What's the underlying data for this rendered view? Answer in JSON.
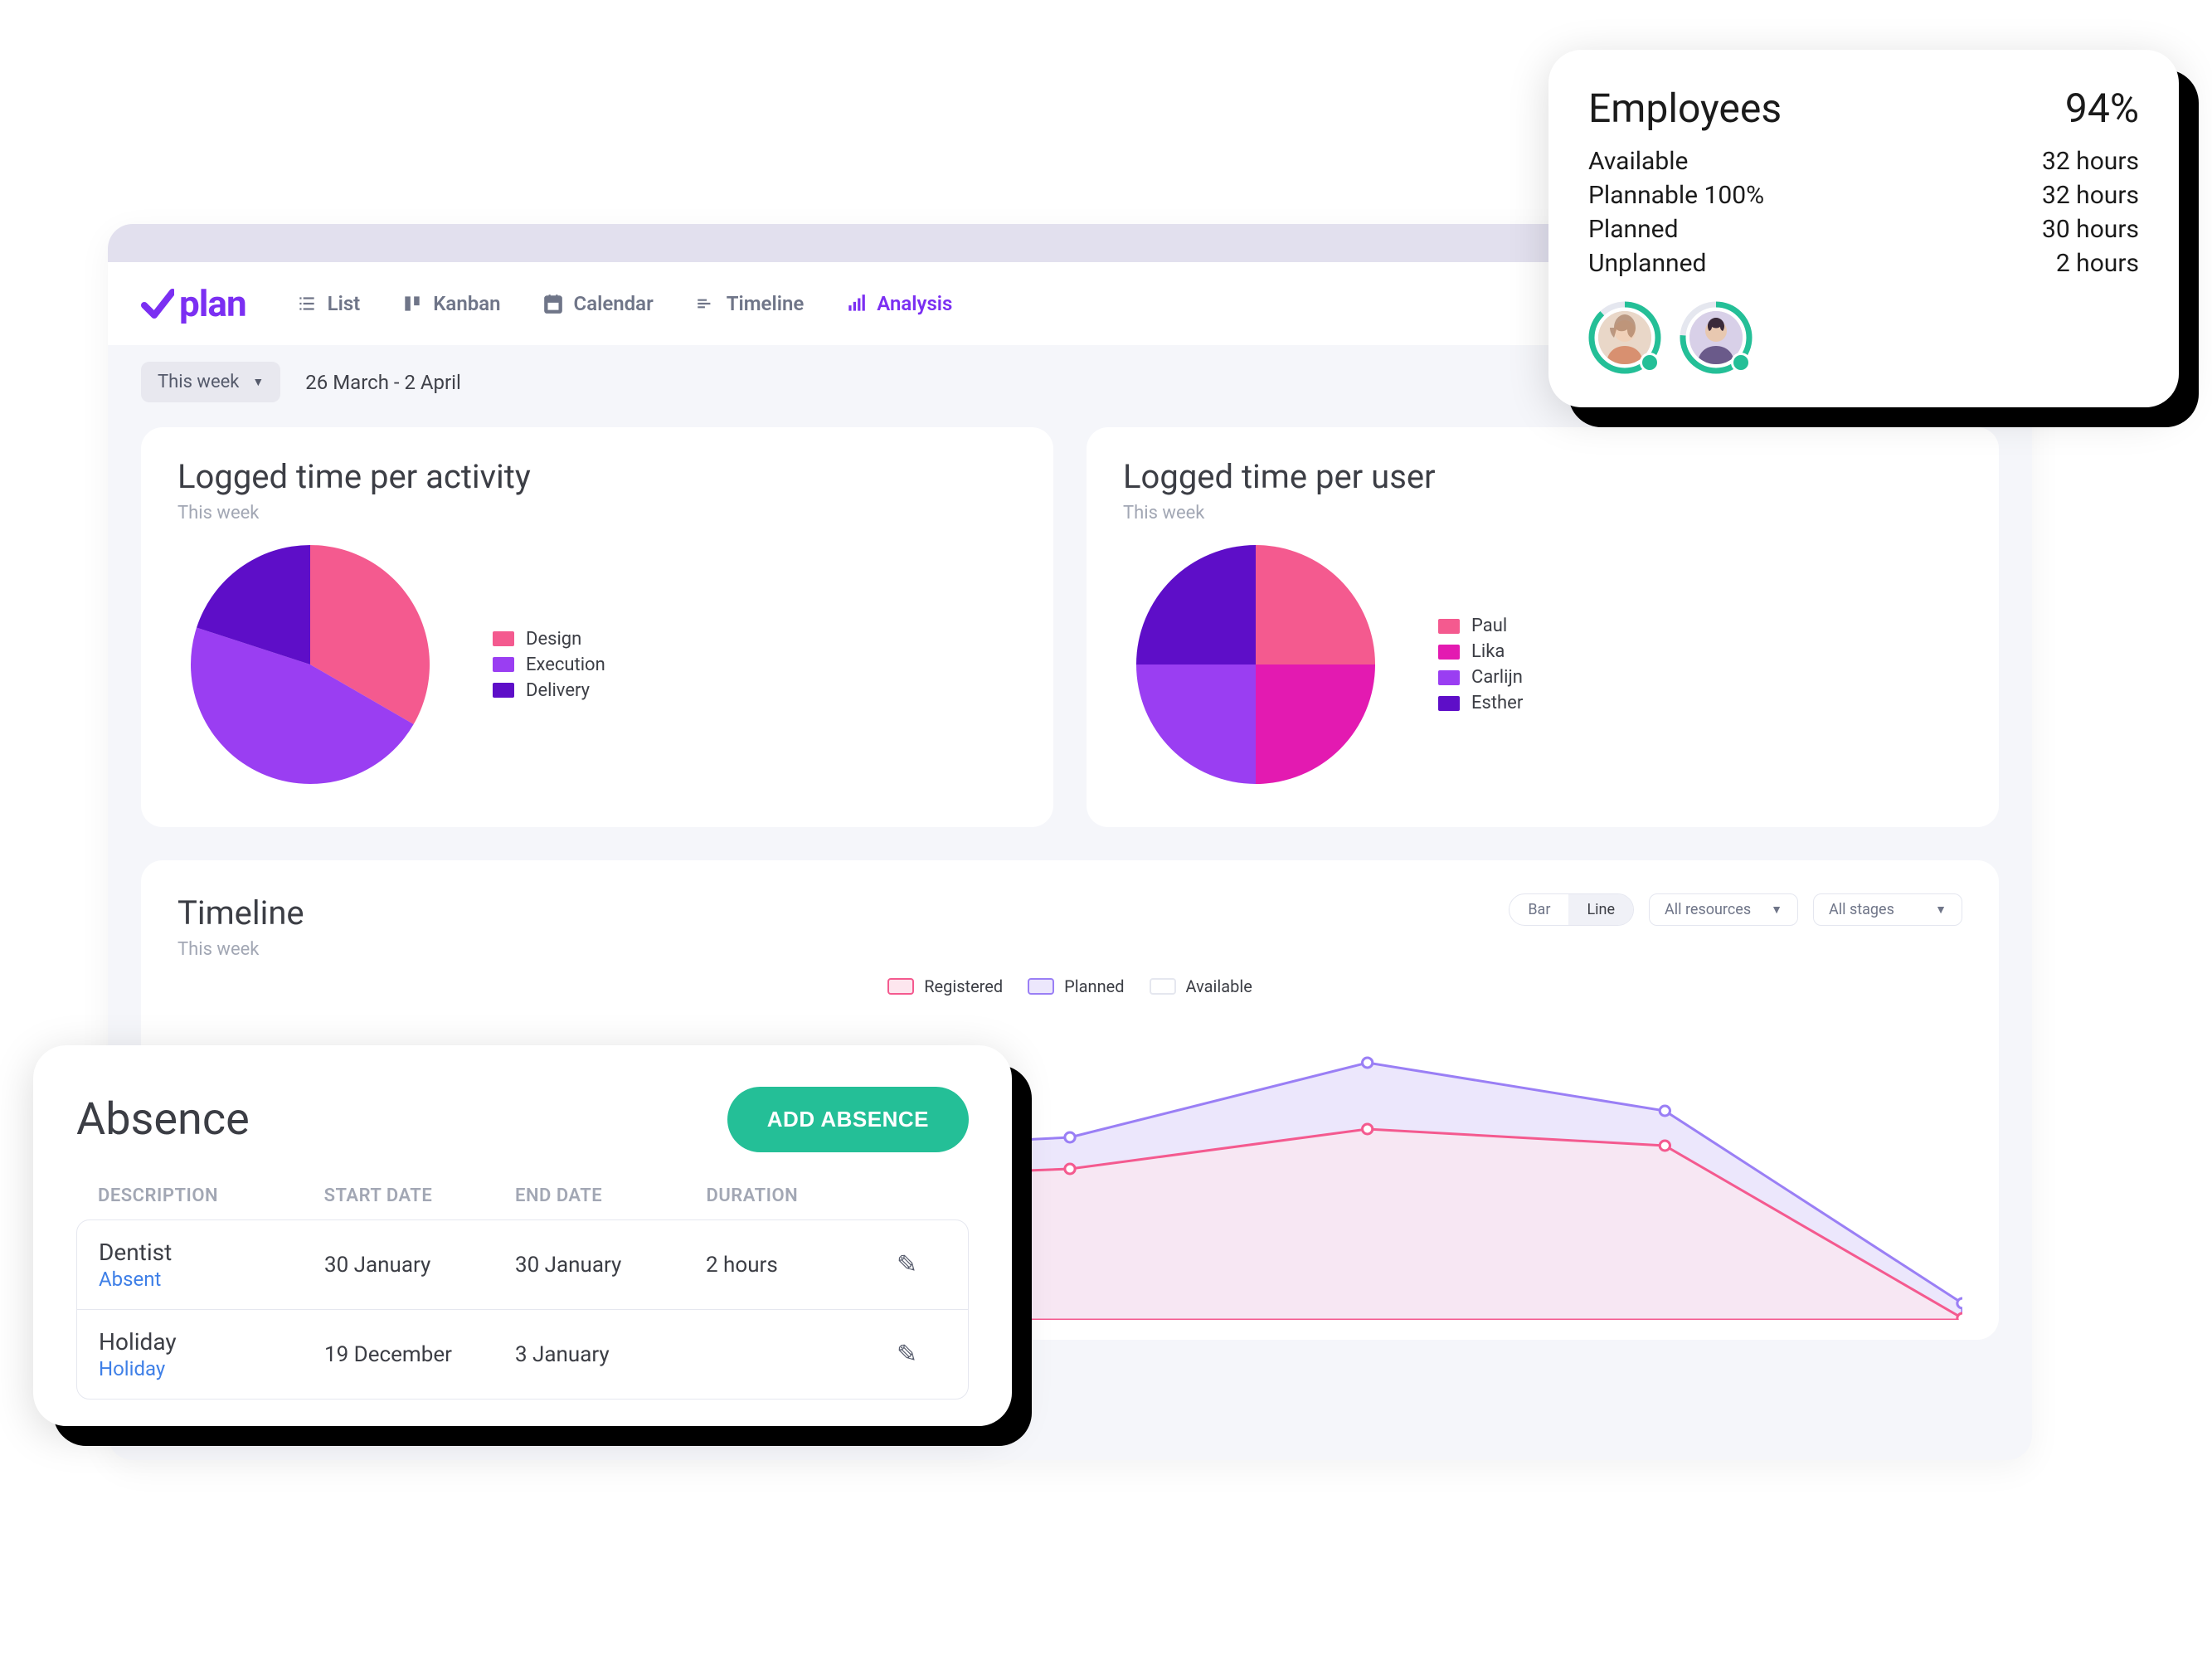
{
  "header": {
    "logo_text": "plan",
    "tabs": {
      "list": "List",
      "kanban": "Kanban",
      "calendar": "Calendar",
      "timeline": "Timeline",
      "analysis": "Analysis"
    }
  },
  "toolbar": {
    "range_label": "This week",
    "date_range": "26 March - 2 April"
  },
  "activity_card": {
    "title": "Logged time per activity",
    "subtitle": "This week",
    "legend": {
      "design": "Design",
      "execution": "Execution",
      "delivery": "Delivery"
    }
  },
  "user_card": {
    "title": "Logged time per user",
    "subtitle": "This week",
    "legend": {
      "paul": "Paul",
      "lika": "Lika",
      "carlijn": "Carlijn",
      "esther": "Esther"
    }
  },
  "timeline": {
    "title": "Timeline",
    "subtitle": "This week",
    "seg": {
      "bar": "Bar",
      "line": "Line"
    },
    "resources": "All resources",
    "stages": "All stages",
    "legend": {
      "registered": "Registered",
      "planned": "Planned",
      "available": "Available"
    }
  },
  "absence": {
    "title": "Absence",
    "add_button": "ADD ABSENCE",
    "headers": {
      "desc": "DESCRIPTION",
      "start": "START DATE",
      "end": "END DATE",
      "duration": "DURATION"
    },
    "rows": [
      {
        "title": "Dentist",
        "tag": "Absent",
        "start": "30 January",
        "end": "30 January",
        "duration": "2 hours"
      },
      {
        "title": "Holiday",
        "tag": "Holiday",
        "start": "19 December",
        "end": "3 January",
        "duration": ""
      }
    ]
  },
  "employees": {
    "title": "Employees",
    "percent": "94%",
    "rows": [
      {
        "label": "Available",
        "value": "32 hours"
      },
      {
        "label": "Plannable 100%",
        "value": "32 hours"
      },
      {
        "label": "Planned",
        "value": "30 hours"
      },
      {
        "label": "Unplanned",
        "value": "2 hours"
      }
    ]
  },
  "colors": {
    "pink": "#f45a8f",
    "magenta": "#e31ab1",
    "violet": "#9a3ef2",
    "purple": "#5e0ec8",
    "green": "#24bf97"
  },
  "chart_data": [
    {
      "type": "pie",
      "title": "Logged time per activity",
      "series": [
        {
          "name": "Design",
          "value": 33,
          "color": "#f45a8f"
        },
        {
          "name": "Execution",
          "value": 37,
          "color": "#9a3ef2"
        },
        {
          "name": "Delivery",
          "value": 30,
          "color": "#5e0ec8"
        }
      ]
    },
    {
      "type": "pie",
      "title": "Logged time per user",
      "series": [
        {
          "name": "Paul",
          "value": 25,
          "color": "#f45a8f"
        },
        {
          "name": "Lika",
          "value": 25,
          "color": "#e31ab1"
        },
        {
          "name": "Carlijn",
          "value": 25,
          "color": "#9a3ef2"
        },
        {
          "name": "Esther",
          "value": 25,
          "color": "#5e0ec8"
        }
      ]
    },
    {
      "type": "area",
      "title": "Timeline",
      "x": [
        0,
        1,
        2,
        3,
        4,
        5,
        6
      ],
      "series": [
        {
          "name": "Available",
          "values": [
            90,
            90,
            90,
            90,
            90,
            90,
            90
          ],
          "color": "#ffffff"
        },
        {
          "name": "Planned",
          "values": [
            58,
            63,
            53,
            58,
            82,
            66,
            5
          ],
          "color": "#9a7ff5"
        },
        {
          "name": "Registered",
          "values": [
            50,
            55,
            44,
            48,
            61,
            55,
            0
          ],
          "color": "#f45a8f"
        }
      ],
      "ylim": [
        0,
        100
      ]
    }
  ]
}
